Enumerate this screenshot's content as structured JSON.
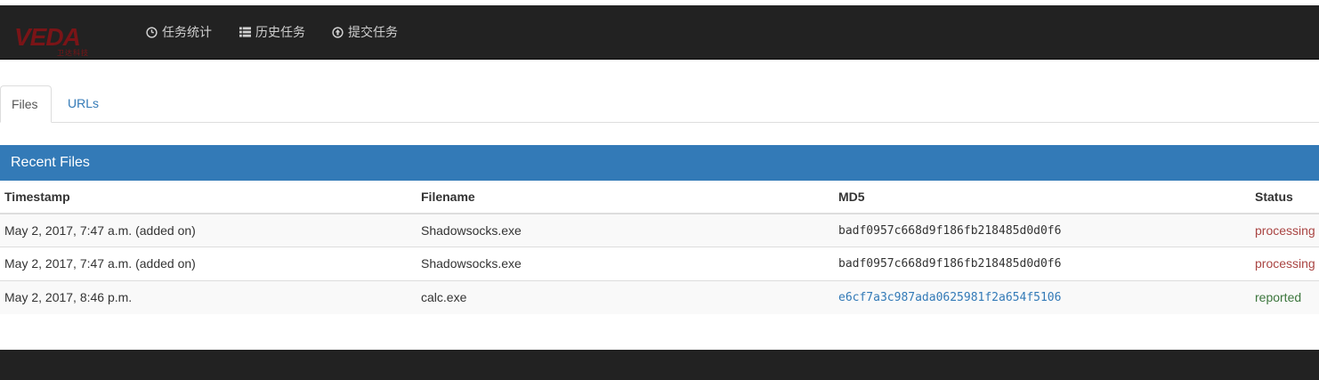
{
  "brand": {
    "logo_text": "VEDA",
    "logo_subtext": "卫达科技",
    "logo_color": "#7a1417"
  },
  "nav": {
    "items": [
      {
        "label": "任务统计",
        "icon": "dashboard-icon"
      },
      {
        "label": "历史任务",
        "icon": "list-icon"
      },
      {
        "label": "提交任务",
        "icon": "upload-circle-icon"
      }
    ]
  },
  "tabs": [
    {
      "label": "Files",
      "active": true
    },
    {
      "label": "URLs",
      "active": false
    }
  ],
  "panel": {
    "title": "Recent Files",
    "columns": [
      "Timestamp",
      "Filename",
      "MD5",
      "Status"
    ],
    "rows": [
      {
        "timestamp": "May 2, 2017, 7:47 a.m. (added on)",
        "filename": "Shadowsocks.exe",
        "md5": "badf0957c668d9f186fb218485d0d0f6",
        "md5_link": false,
        "status": "processing"
      },
      {
        "timestamp": "May 2, 2017, 7:47 a.m. (added on)",
        "filename": "Shadowsocks.exe",
        "md5": "badf0957c668d9f186fb218485d0d0f6",
        "md5_link": false,
        "status": "processing"
      },
      {
        "timestamp": "May 2, 2017, 8:46 p.m.",
        "filename": "calc.exe",
        "md5": "e6cf7a3c987ada0625981f2a654f5106",
        "md5_link": true,
        "status": "reported"
      }
    ]
  },
  "colors": {
    "navbar": "#222222",
    "primary": "#337ab7",
    "processing": "#a94442",
    "reported": "#3c763d"
  }
}
